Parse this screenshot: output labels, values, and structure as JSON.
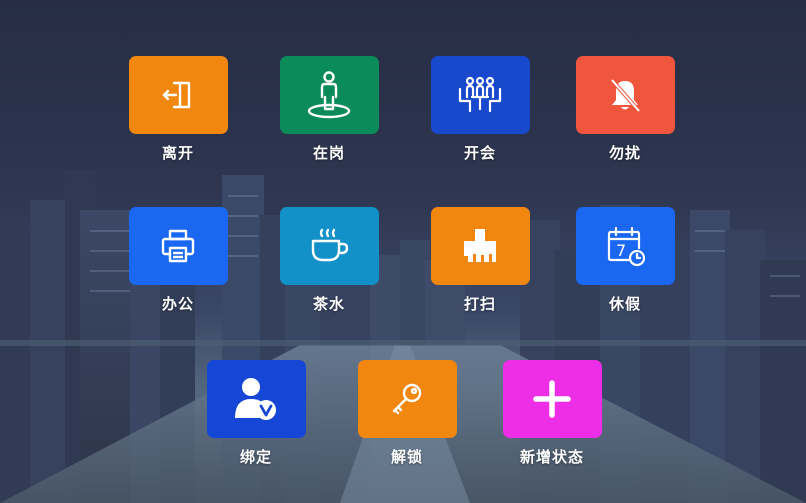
{
  "tiles": [
    {
      "key": "leave",
      "label": "离开",
      "color": "#f2870f",
      "icon": "door-exit-icon"
    },
    {
      "key": "onduty",
      "label": "在岗",
      "color": "#0b8a5a",
      "icon": "person-standing-icon"
    },
    {
      "key": "meeting",
      "label": "开会",
      "color": "#1848cc",
      "icon": "meeting-people-icon"
    },
    {
      "key": "dnd",
      "label": "勿扰",
      "color": "#f0553e",
      "icon": "bell-off-icon"
    },
    {
      "key": "office",
      "label": "办公",
      "color": "#1a67f2",
      "icon": "printer-icon"
    },
    {
      "key": "tea",
      "label": "茶水",
      "color": "#1290c8",
      "icon": "coffee-cup-icon"
    },
    {
      "key": "clean",
      "label": "打扫",
      "color": "#f2870f",
      "icon": "broom-icon"
    },
    {
      "key": "holiday",
      "label": "休假",
      "color": "#1a67f2",
      "icon": "calendar-clock-icon"
    },
    {
      "key": "bind",
      "label": "绑定",
      "color": "#1646d6",
      "icon": "user-verified-icon"
    },
    {
      "key": "unlock",
      "label": "解锁",
      "color": "#f2870f",
      "icon": "key-icon"
    },
    {
      "key": "add",
      "label": "新增状态",
      "color": "#ee2ee6",
      "icon": "plus-icon"
    }
  ],
  "calendar_digit": "7"
}
